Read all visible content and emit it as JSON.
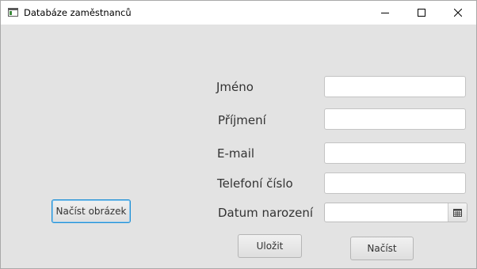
{
  "window": {
    "title": "Databáze zaměstnanců",
    "icon": "app-window-icon",
    "controls": [
      "minimize-icon",
      "maximize-icon",
      "close-icon"
    ]
  },
  "form": {
    "first_name_label": "Jméno",
    "first_name_value": "",
    "last_name_label": "Příjmení",
    "last_name_value": "",
    "email_label": "E-mail",
    "email_value": "",
    "phone_label": "Telefoní číslo",
    "phone_value": "",
    "birthdate_label": "Datum narození",
    "birthdate_value": "",
    "calendar_icon": "calendar-icon"
  },
  "actions": {
    "load_image_label": "Načíst obrázek",
    "save_label": "Uložit",
    "load_label": "Načíst"
  },
  "colors": {
    "background": "#e3e3e3",
    "focus_border": "#1e90d6"
  }
}
